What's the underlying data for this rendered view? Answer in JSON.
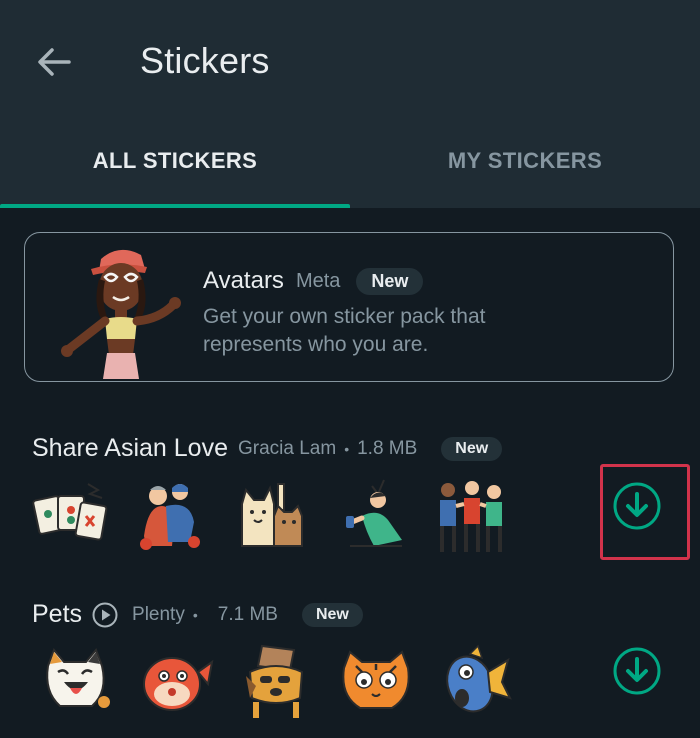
{
  "header": {
    "title": "Stickers",
    "back_icon": "arrow-left-icon"
  },
  "tabs": [
    {
      "label": "ALL STICKERS",
      "active": true
    },
    {
      "label": "MY STICKERS",
      "active": false
    }
  ],
  "avatar_promo": {
    "name": "Avatars",
    "author": "Meta",
    "badge": "New",
    "description": "Get your own sticker pack that represents who you are."
  },
  "packs": [
    {
      "name": "Share Asian Love",
      "author": "Gracia Lam",
      "separator": "•",
      "size": "1.8 MB",
      "badge": "New",
      "stickers": [
        "mahjong-tiles-sticker",
        "two-friends-hug-sticker",
        "lucky-cats-sticker",
        "dancing-woman-sticker",
        "group-of-friends-sticker"
      ],
      "action_icon": "download-icon",
      "highlighted": true
    },
    {
      "name": "Pets",
      "author": "Plenty",
      "separator": "•",
      "size": "7.1 MB",
      "badge": "New",
      "animated_icon": "play-icon",
      "stickers": [
        "calico-cat-sticker",
        "pufferfish-sticker",
        "dog-with-box-sticker",
        "tiger-cat-sticker",
        "surprised-fish-sticker"
      ],
      "action_icon": "download-icon",
      "highlighted": false
    }
  ],
  "colors": {
    "accent": "#00a884",
    "header_bg": "#1f2c34",
    "body_bg": "#121b22",
    "highlight": "#d2334b"
  }
}
